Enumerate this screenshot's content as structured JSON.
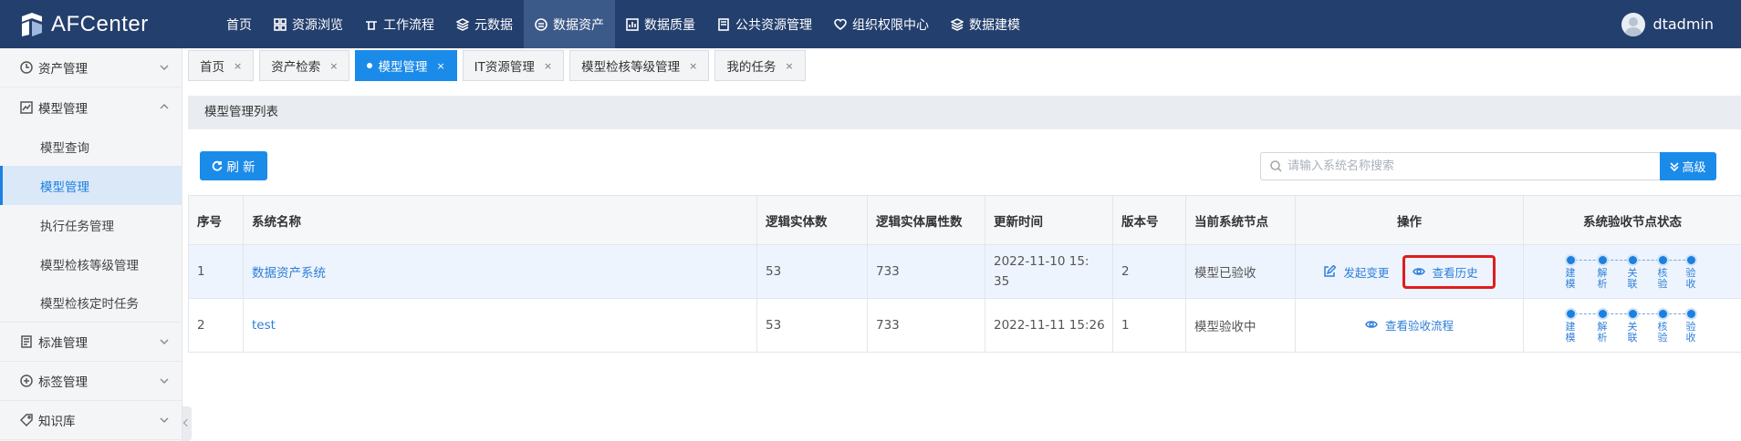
{
  "app": {
    "logo_text": "AFCenter",
    "user_name": "dtadmin"
  },
  "nav": [
    {
      "label": "首页",
      "icon": "none"
    },
    {
      "label": "资源浏览",
      "icon": "grid-icon"
    },
    {
      "label": "工作流程",
      "icon": "workflow-icon"
    },
    {
      "label": "元数据",
      "icon": "layers-icon"
    },
    {
      "label": "数据资产",
      "icon": "asset-icon"
    },
    {
      "label": "数据质量",
      "icon": "quality-icon"
    },
    {
      "label": "公共资源管理",
      "icon": "resource-icon"
    },
    {
      "label": "组织权限中心",
      "icon": "shield-icon"
    },
    {
      "label": "数据建模",
      "icon": "modeling-icon"
    }
  ],
  "sidebar": {
    "asset_mgmt": "资产管理",
    "model_mgmt": "模型管理",
    "model_sub": [
      "模型查询",
      "模型管理",
      "执行任务管理",
      "模型检核等级管理",
      "模型检核定时任务"
    ],
    "standard_mgmt": "标准管理",
    "tag_mgmt": "标签管理",
    "knowledge": "知识库"
  },
  "tabs": [
    {
      "label": "首页"
    },
    {
      "label": "资产检索"
    },
    {
      "label": "模型管理"
    },
    {
      "label": "IT资源管理"
    },
    {
      "label": "模型检核等级管理"
    },
    {
      "label": "我的任务"
    }
  ],
  "tab_close": "×",
  "panel": {
    "title": "模型管理列表",
    "refresh_label": "刷 新",
    "search_placeholder": "请输入系统名称搜索",
    "advanced_label": "高级"
  },
  "table": {
    "headers": [
      "序号",
      "系统名称",
      "逻辑实体数",
      "逻辑实体属性数",
      "更新时间",
      "版本号",
      "当前系统节点",
      "操作",
      "系统验收节点状态"
    ],
    "rows": [
      {
        "no": "1",
        "name": "数据资产系统",
        "entities": "53",
        "attrs": "733",
        "time": "2022-11-10 15:35",
        "version": "2",
        "node": "模型已验收",
        "op1": "发起变更",
        "op2": "查看历史"
      },
      {
        "no": "2",
        "name": "test",
        "entities": "53",
        "attrs": "733",
        "time": "2022-11-11 15:26",
        "version": "1",
        "node": "模型验收中",
        "op1": "查看验收流程"
      }
    ],
    "status_nodes": [
      "建模",
      "解析",
      "关联",
      "核验",
      "验收"
    ]
  },
  "colors": {
    "primary": "#1b8bea",
    "topbar": "#233f6d",
    "highlight_border": "#e11c1c"
  }
}
